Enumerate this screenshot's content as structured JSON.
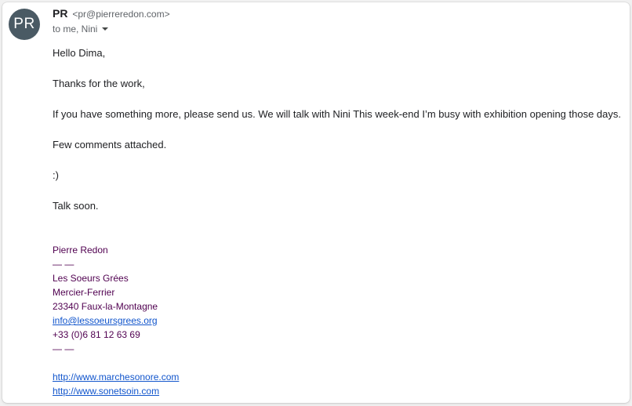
{
  "sender": {
    "avatar_initials": "PR",
    "avatar_color": "#4a5a64",
    "name": "PR",
    "email": "<pr@pierreredon.com>",
    "recipients": "to me, Nini",
    "recipients_caret_icon": "caret-down-icon"
  },
  "body": {
    "greeting": "Hello Dima,",
    "paragraphs": [
      "Thanks for the work,",
      "If you have something more, please send us. We will talk with Nini This week-end I’m busy with exhibition opening those days.",
      "Few comments attached.",
      ":)",
      "Talk soon."
    ]
  },
  "signature": {
    "name": "Pierre Redon",
    "divider_1": "— —",
    "org": "Les Soeurs Grées",
    "street": "Mercier-Ferrier",
    "city": "23340 Faux-la-Montagne",
    "email": "info@lessoeursgrees.org",
    "phone": "+33 (0)6 81 12 63 69",
    "divider_2": "— —",
    "signature_color": "#500050",
    "link_color": "#1155cc"
  },
  "links": [
    "http://www.marchesonore.com",
    "http://www.sonetsoin.com"
  ]
}
